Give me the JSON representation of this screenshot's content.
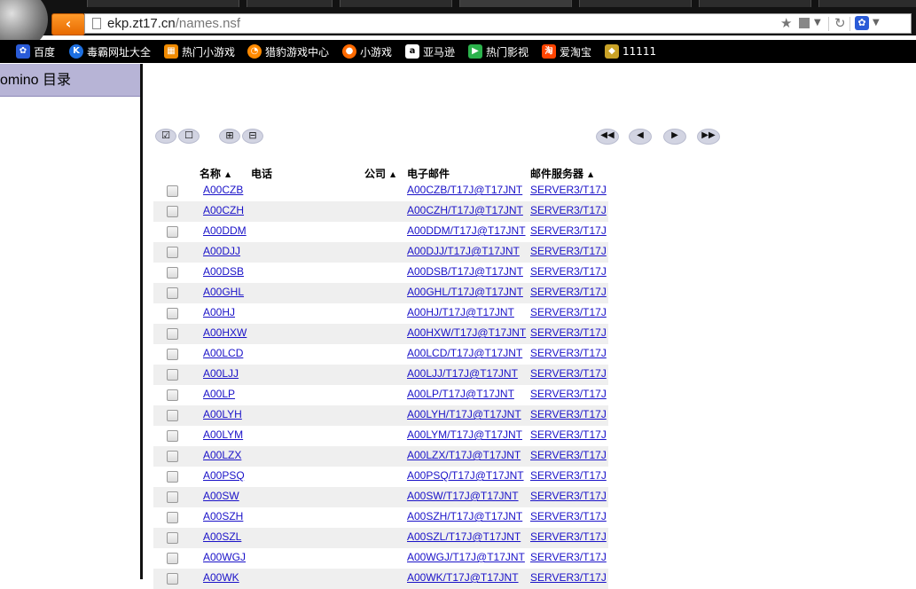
{
  "browser": {
    "url_host": "ekp.zt17.cn",
    "url_path": "/names.nsf",
    "back_icon": "chevron-left-icon",
    "bookmarks": [
      {
        "label": "百度",
        "icon": "paw-icon",
        "color": "#2a5bd7",
        "glyph": "✿"
      },
      {
        "label": "毒霸网址大全",
        "icon": "k-icon",
        "color": "#1d6fe0",
        "glyph": "K"
      },
      {
        "label": "热门小游戏",
        "icon": "game-icon",
        "color": "#f08a00",
        "glyph": "▦"
      },
      {
        "label": "猎豹游戏中心",
        "icon": "cheetah-icon",
        "color": "#ff8a00",
        "glyph": "◔"
      },
      {
        "label": "小游戏",
        "icon": "game-ball-icon",
        "color": "#ff6a00",
        "glyph": "●"
      },
      {
        "label": "亚马逊",
        "icon": "amazon-icon",
        "color": "#ffffff",
        "glyph": "a"
      },
      {
        "label": "热门影视",
        "icon": "play-icon",
        "color": "#2bb24c",
        "glyph": "▶"
      },
      {
        "label": "爱淘宝",
        "icon": "taobao-icon",
        "color": "#ff4400",
        "glyph": "淘"
      },
      {
        "label": "11111",
        "icon": "cube-icon",
        "color": "#c9a227",
        "glyph": "◆"
      }
    ]
  },
  "left": {
    "title": "omino 目录"
  },
  "toolbar": {
    "select_all_icon": "checkbox-checked-icon",
    "deselect_icon": "checkbox-empty-icon",
    "expand_icon": "expand-icon",
    "collapse_icon": "collapse-icon",
    "first_icon": "first-page-icon",
    "prev_icon": "prev-page-icon",
    "next_icon": "next-page-icon",
    "last_icon": "last-page-icon"
  },
  "table": {
    "headers": {
      "name": "名称",
      "phone": "电话",
      "company": "公司",
      "email": "电子邮件",
      "server": "邮件服务器"
    },
    "rows": [
      {
        "name": "A00CZB",
        "email": "A00CZB/T17J@T17JNT",
        "server": "SERVER3/T17J"
      },
      {
        "name": "A00CZH",
        "email": "A00CZH/T17J@T17JNT",
        "server": "SERVER3/T17J"
      },
      {
        "name": "A00DDM",
        "email": "A00DDM/T17J@T17JNT",
        "server": "SERVER3/T17J"
      },
      {
        "name": "A00DJJ",
        "email": "A00DJJ/T17J@T17JNT",
        "server": "SERVER3/T17J"
      },
      {
        "name": "A00DSB",
        "email": "A00DSB/T17J@T17JNT",
        "server": "SERVER3/T17J"
      },
      {
        "name": "A00GHL",
        "email": "A00GHL/T17J@T17JNT",
        "server": "SERVER3/T17J"
      },
      {
        "name": "A00HJ",
        "email": "A00HJ/T17J@T17JNT",
        "server": "SERVER3/T17J"
      },
      {
        "name": "A00HXW",
        "email": "A00HXW/T17J@T17JNT",
        "server": "SERVER3/T17J"
      },
      {
        "name": "A00LCD",
        "email": "A00LCD/T17J@T17JNT",
        "server": "SERVER3/T17J"
      },
      {
        "name": "A00LJJ",
        "email": "A00LJJ/T17J@T17JNT",
        "server": "SERVER3/T17J"
      },
      {
        "name": "A00LP",
        "email": "A00LP/T17J@T17JNT",
        "server": "SERVER3/T17J"
      },
      {
        "name": "A00LYH",
        "email": "A00LYH/T17J@T17JNT",
        "server": "SERVER3/T17J"
      },
      {
        "name": "A00LYM",
        "email": "A00LYM/T17J@T17JNT",
        "server": "SERVER3/T17J"
      },
      {
        "name": "A00LZX",
        "email": "A00LZX/T17J@T17JNT",
        "server": "SERVER3/T17J"
      },
      {
        "name": "A00PSQ",
        "email": "A00PSQ/T17J@T17JNT",
        "server": "SERVER3/T17J"
      },
      {
        "name": "A00SW",
        "email": "A00SW/T17J@T17JNT",
        "server": "SERVER3/T17J"
      },
      {
        "name": "A00SZH",
        "email": "A00SZH/T17J@T17JNT",
        "server": "SERVER3/T17J"
      },
      {
        "name": "A00SZL",
        "email": "A00SZL/T17J@T17JNT",
        "server": "SERVER3/T17J"
      },
      {
        "name": "A00WGJ",
        "email": "A00WGJ/T17J@T17JNT",
        "server": "SERVER3/T17J"
      },
      {
        "name": "A00WK",
        "email": "A00WK/T17J@T17JNT",
        "server": "SERVER3/T17J"
      }
    ]
  }
}
